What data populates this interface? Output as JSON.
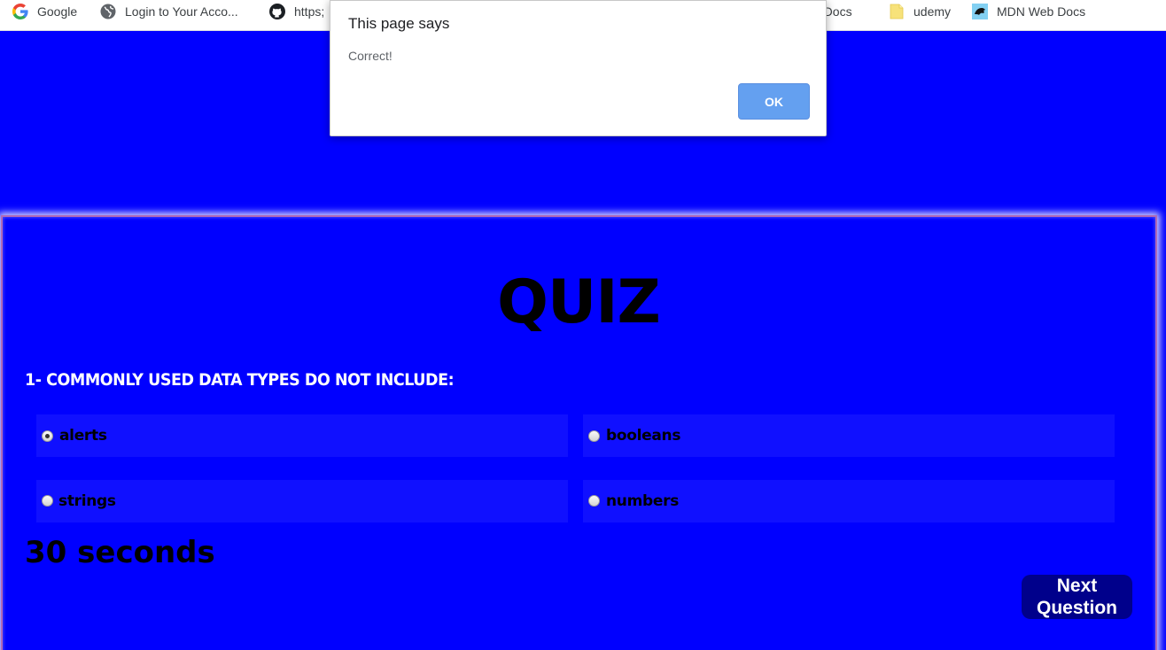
{
  "bookmarks": [
    {
      "label": "Google",
      "icon": "google-icon"
    },
    {
      "label": "Login to Your Acco...",
      "icon": "globe-icon"
    },
    {
      "label": "https;",
      "icon": "github-icon"
    },
    {
      "label": "b Docs",
      "icon": "none"
    },
    {
      "label": "udemy",
      "icon": "folder-icon"
    },
    {
      "label": "MDN Web Docs",
      "icon": "mdn-icon"
    }
  ],
  "dialog": {
    "title": "This page says",
    "message": "Correct!",
    "ok_label": "OK",
    "ok_color": "#64a0f0"
  },
  "quiz": {
    "title": "QUIZ",
    "question": "1- COMMONLY USED DATA TYPES DO NOT INCLUDE:",
    "options": [
      {
        "label": "alerts",
        "checked": true
      },
      {
        "label": "booleans",
        "checked": false
      },
      {
        "label": "strings",
        "checked": false
      },
      {
        "label": "numbers",
        "checked": false
      }
    ],
    "timer": "30 seconds",
    "next_label_line1": "Next",
    "next_label_line2": "Question"
  },
  "colors": {
    "page_background": "#0000ff",
    "option_background": "#1010ff",
    "next_button": "#00008b"
  }
}
